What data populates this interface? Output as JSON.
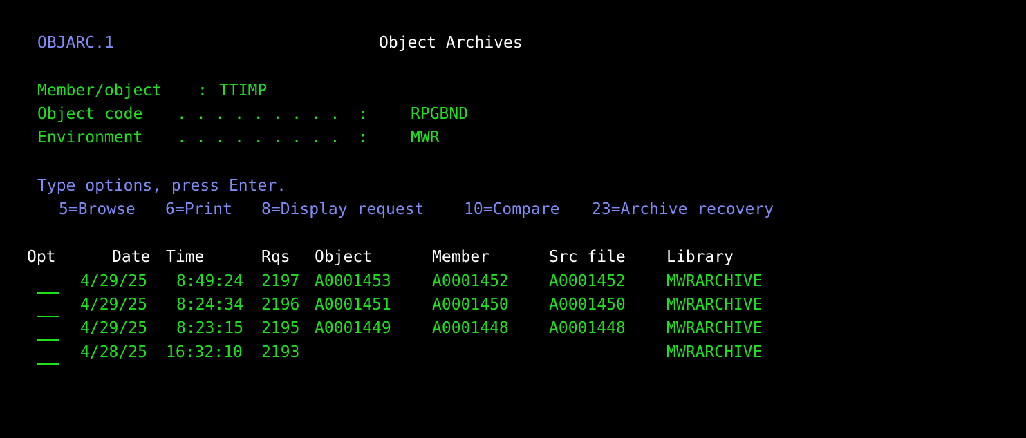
{
  "header": {
    "program_id": "OBJARC.1",
    "title": "Object Archives"
  },
  "info": {
    "member_object_label": "Member/object",
    "member_object_sep": ":",
    "member_object_value": "TTIMP",
    "object_code_label": "Object code",
    "object_code_dots": ". . . . . . . . .",
    "object_code_sep": ":",
    "object_code_value": "RPGBND",
    "environment_label": "Environment",
    "environment_dots": ". . . . . . . . .",
    "environment_sep": ":",
    "environment_value": "MWR"
  },
  "instructions": {
    "prompt": "Type options, press Enter.",
    "options": [
      "5=Browse",
      "6=Print",
      "8=Display request",
      "10=Compare",
      "23=Archive recovery"
    ]
  },
  "table": {
    "columns": {
      "opt": "Opt",
      "date": "Date",
      "time": "Time",
      "rqs": "Rqs",
      "object": "Object",
      "member": "Member",
      "src_file": "Src file",
      "library": "Library"
    },
    "rows": [
      {
        "opt": "",
        "date": "4/29/25",
        "time": "8:49:24",
        "rqs": "2197",
        "object": "A0001453",
        "member": "A0001452",
        "src_file": "A0001452",
        "library": "MWRARCHIVE"
      },
      {
        "opt": "",
        "date": "4/29/25",
        "time": "8:24:34",
        "rqs": "2196",
        "object": "A0001451",
        "member": "A0001450",
        "src_file": "A0001450",
        "library": "MWRARCHIVE"
      },
      {
        "opt": "",
        "date": "4/29/25",
        "time": "8:23:15",
        "rqs": "2195",
        "object": "A0001449",
        "member": "A0001448",
        "src_file": "A0001448",
        "library": "MWRARCHIVE"
      },
      {
        "opt": "",
        "date": "4/28/25",
        "time": "16:32:10",
        "rqs": "2193",
        "object": "",
        "member": "",
        "src_file": "",
        "library": "MWRARCHIVE"
      }
    ]
  },
  "colors": {
    "background": "#000000",
    "blue_text": "#7f8cf5",
    "white_text": "#ffffff",
    "green_text": "#1fe01f"
  }
}
